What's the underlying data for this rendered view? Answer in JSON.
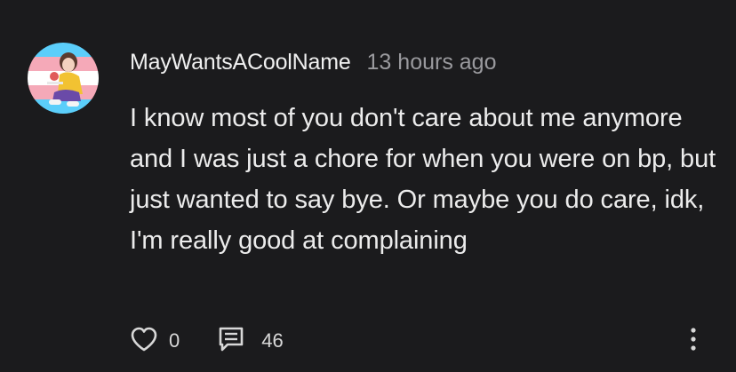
{
  "comment": {
    "username": "MayWantsACoolName",
    "timestamp": "13 hours ago",
    "text": "I know most of you don't care about me anymore and I was just a chore for when you were on bp, but just wanted to say bye. Or maybe you do care, idk, I'm really good at complaining",
    "likes": "0",
    "replies": "46"
  },
  "icons": {
    "like": "heart-icon",
    "reply": "comment-icon",
    "more": "more-vertical-icon"
  },
  "colors": {
    "background": "#1b1b1d",
    "text": "#ececec",
    "muted": "#9a9a9e",
    "avatar_flag": [
      "#5bcefa",
      "#f5a9b8",
      "#ffffff",
      "#f5a9b8",
      "#5bcefa"
    ]
  }
}
